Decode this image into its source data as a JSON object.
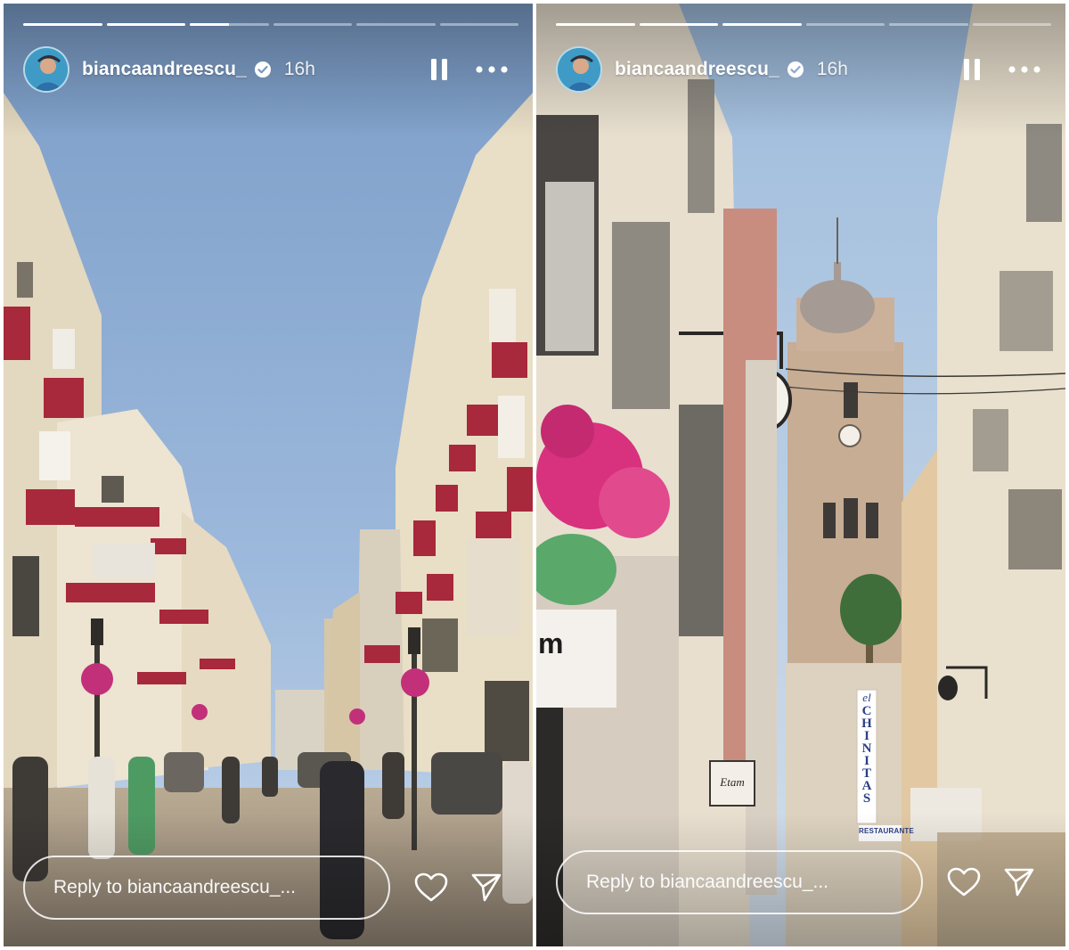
{
  "stories": [
    {
      "progress": [
        1,
        1,
        0.5,
        0,
        0,
        0
      ],
      "username": "biancaandreescu_",
      "time": "16h",
      "reply_placeholder": "Reply to biancaandreescu_...",
      "scene": "Busy pedestrian shopping street with cream buildings, red balconies and blue sky"
    },
    {
      "progress": [
        1,
        1,
        1,
        0,
        0,
        0
      ],
      "username": "biancaandreescu_",
      "time": "16h",
      "reply_placeholder": "Reply to biancaandreescu_...",
      "signs": {
        "tower_sign": [
          "el",
          "CHINITAS"
        ],
        "restaurant_sign": "RESTAURANTE",
        "shop_sign": "Etam",
        "shop_fragment": "m"
      }
    }
  ],
  "icons": {
    "verified": "verified-badge-icon",
    "pause": "pause-icon",
    "more": "more-icon",
    "heart": "heart-icon",
    "send": "send-icon"
  },
  "colors": {
    "sky": "#8aaed6",
    "sky_right": "#a9c3df",
    "building_cream": "#e6dcc7",
    "balcony_red": "#a8283c",
    "flowers": "#e0307a",
    "ui_white": "#ffffff"
  }
}
